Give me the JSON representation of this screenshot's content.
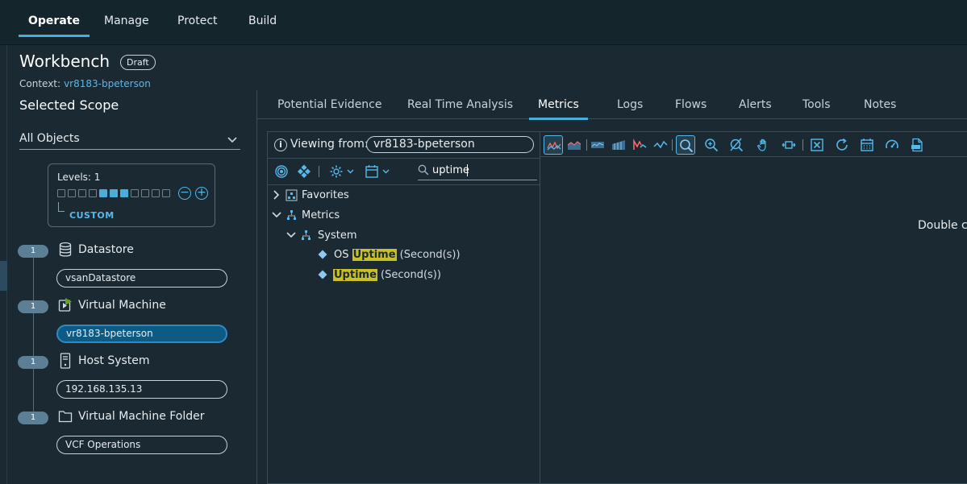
{
  "nav": {
    "tabs": [
      "Operate",
      "Manage",
      "Protect",
      "Build"
    ],
    "active": "Operate"
  },
  "header": {
    "title": "Workbench",
    "badge": "Draft",
    "context_label": "Context:",
    "context_value": "vr8183-bpeterson"
  },
  "scope": {
    "title": "Selected Scope",
    "dropdown_value": "All Objects",
    "levels_label": "Levels: 1",
    "levels_mode": "CUSTOM",
    "items": [
      {
        "count": "1",
        "label": "Datastore",
        "value": "vsanDatastore",
        "icon": "datastore-icon"
      },
      {
        "count": "1",
        "label": "Virtual Machine",
        "value": "vr8183-bpeterson",
        "icon": "virtual-machine-icon"
      },
      {
        "count": "1",
        "label": "Host System",
        "value": "192.168.135.13",
        "icon": "host-system-icon"
      },
      {
        "count": "1",
        "label": "Virtual Machine Folder",
        "value": "VCF Operations",
        "icon": "folder-icon"
      }
    ]
  },
  "tabs": {
    "items": [
      "Potential Evidence",
      "Real Time Analysis",
      "Metrics",
      "Logs",
      "Flows",
      "Alerts",
      "Tools",
      "Notes"
    ],
    "active": "Metrics"
  },
  "metrics": {
    "viewing_label": "Viewing from:",
    "viewing_value": "vr8183-bpeterson",
    "search_value": "uptime",
    "tree": {
      "favorites": "Favorites",
      "metrics": "Metrics",
      "system": "System",
      "leaf1_prefix": "OS",
      "leaf1_match": "Uptime",
      "leaf1_suffix": "(Second(s))",
      "leaf2_match": "Uptime",
      "leaf2_suffix": "(Second(s))"
    }
  },
  "chart_area": {
    "hint": "Double cl"
  },
  "colors": {
    "accent": "#49afd9",
    "highlight": "#c9c027",
    "selected_field": "#0d5b84"
  }
}
